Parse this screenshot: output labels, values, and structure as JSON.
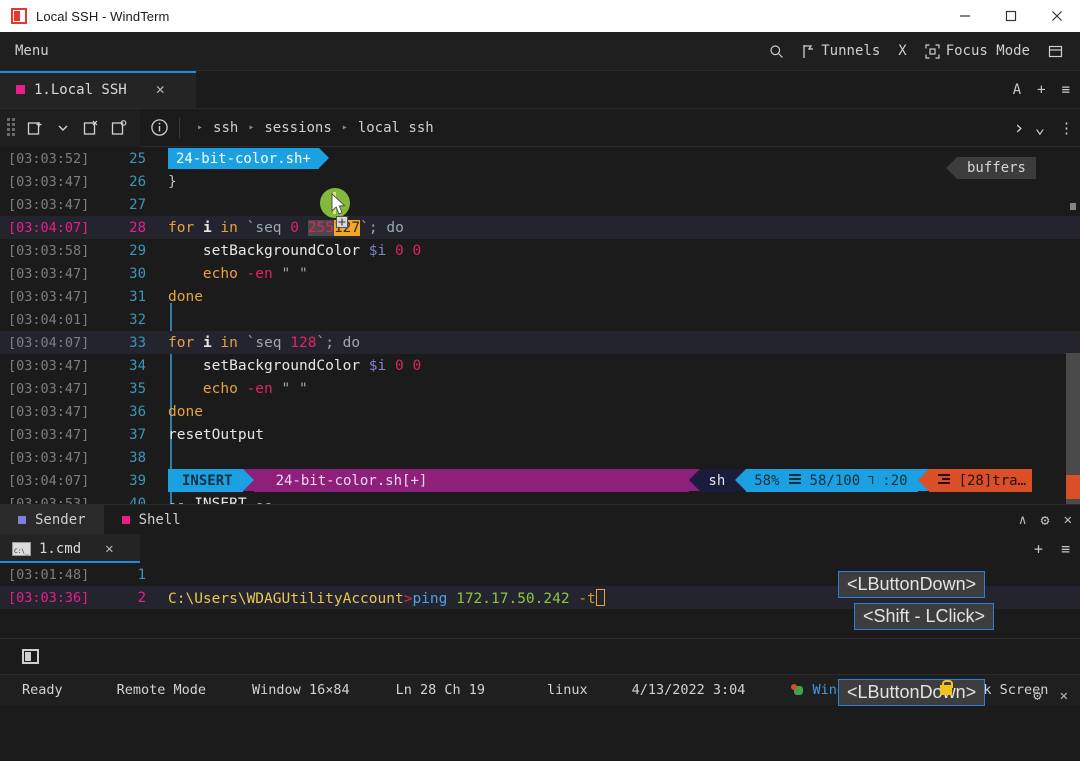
{
  "window": {
    "title": "Local SSH - WindTerm",
    "logo_icon": "windterm-logo-icon",
    "minimize_label": "─",
    "maximize_label": "□",
    "close_label": "✕"
  },
  "menubar": {
    "menu_label": "Menu",
    "search_icon": "search-icon",
    "tunnels_icon": "tunnel-flag-icon",
    "tunnels_label": "Tunnels",
    "x_label": "X",
    "focus_icon": "focus-frame-icon",
    "focus_label": "Focus Mode",
    "layout_icon": "layout-panel-icon"
  },
  "session_tabs": {
    "items": [
      {
        "label": "1.Local SSH",
        "dot_color": "#e91e8c",
        "close_label": "✕",
        "active": true
      }
    ],
    "right_controls": [
      {
        "name": "font-size-button",
        "label": "A"
      },
      {
        "name": "new-tab-button",
        "label": "+"
      },
      {
        "name": "tab-menu-button",
        "label": "≡"
      }
    ]
  },
  "pathbar": {
    "grip_icon": "drag-grip-icon",
    "icons": [
      {
        "name": "new-session-icon",
        "label": "new-session"
      },
      {
        "name": "dropdown-caret-icon",
        "label": "▾"
      },
      {
        "name": "close-session-icon",
        "label": "close-session"
      },
      {
        "name": "clone-session-icon",
        "label": "clone-session"
      },
      {
        "name": "info-icon",
        "label": "i"
      }
    ],
    "crumbs": [
      "ssh",
      "sessions",
      "local ssh"
    ],
    "crumb_arrow": "▸",
    "right_controls": [
      {
        "name": "path-forward-icon",
        "label": "›"
      },
      {
        "name": "path-dropdown-icon",
        "label": "⌄"
      },
      {
        "name": "path-more-icon",
        "label": "⋮"
      }
    ]
  },
  "terminal_upper": {
    "buffers_tag": "buffers",
    "file_tag": "24-bit-color.sh+",
    "rows": [
      {
        "time": "[03:03:52]",
        "line": "25",
        "active": false,
        "highlight": false,
        "kind": "tag"
      },
      {
        "time": "[03:03:47]",
        "line": "26",
        "active": false,
        "highlight": false,
        "kind": "brace",
        "text": "}"
      },
      {
        "time": "[03:03:47]",
        "line": "27",
        "active": false,
        "highlight": false,
        "kind": "blank",
        "text": ""
      },
      {
        "time": "[03:04:07]",
        "line": "28",
        "active": true,
        "highlight": true,
        "kind": "for255"
      },
      {
        "time": "[03:03:58]",
        "line": "29",
        "active": false,
        "highlight": false,
        "kind": "setbg"
      },
      {
        "time": "[03:03:47]",
        "line": "30",
        "active": false,
        "highlight": false,
        "kind": "echo"
      },
      {
        "time": "[03:03:47]",
        "line": "31",
        "active": false,
        "highlight": false,
        "kind": "done"
      },
      {
        "time": "[03:04:01]",
        "line": "32",
        "active": false,
        "highlight": false,
        "kind": "blank",
        "text": ""
      },
      {
        "time": "[03:04:07]",
        "line": "33",
        "active": false,
        "highlight": true,
        "kind": "for128"
      },
      {
        "time": "[03:03:47]",
        "line": "34",
        "active": false,
        "highlight": false,
        "kind": "setbg"
      },
      {
        "time": "[03:03:47]",
        "line": "35",
        "active": false,
        "highlight": false,
        "kind": "echo"
      },
      {
        "time": "[03:03:47]",
        "line": "36",
        "active": false,
        "highlight": false,
        "kind": "done"
      },
      {
        "time": "[03:03:47]",
        "line": "37",
        "active": false,
        "highlight": false,
        "kind": "reset"
      },
      {
        "time": "[03:03:47]",
        "line": "38",
        "active": false,
        "highlight": false,
        "kind": "blank",
        "text": ""
      },
      {
        "time": "[03:04:07]",
        "line": "39",
        "active": false,
        "highlight": false,
        "kind": "statusline"
      },
      {
        "time": "[03:03:53]",
        "line": "40",
        "active": false,
        "highlight": false,
        "kind": "insert",
        "text": "-- INSERT --"
      }
    ],
    "code": {
      "for_kw": "for",
      "i_var": "i",
      "in_kw": "in",
      "backtick": "`",
      "seq_kw": "seq",
      "zero": "0",
      "seg255": "255",
      "seg127": "127",
      "tail_do": "`; do",
      "seq128_text": "128",
      "setbg_fn": "setBackgroundColor",
      "setbg_var": "$i",
      "setbg_args": "0 0",
      "echo_kw": "echo",
      "echo_flag": "-en",
      "echo_str": "\" \"",
      "done_kw": "done",
      "reset_fn": "resetOutput",
      "brace": "}",
      "insert_text": "-- INSERT --"
    },
    "statusline": {
      "mode": "INSERT",
      "file": "24-bit-color.sh[+]",
      "filetype": "sh",
      "percent": "58%",
      "lines_icon": "lines-icon",
      "position": "58/100",
      "col_icon": "⅂",
      "column": ":20",
      "tra_icon": "buffer-list-icon",
      "tra": "[28]tra…"
    }
  },
  "panel": {
    "tabs": [
      {
        "label": "Sender",
        "dot_color": "#7f7fd5",
        "active": true
      },
      {
        "label": "Shell",
        "dot_color": "#e91e8c",
        "active": false
      }
    ],
    "controls": [
      {
        "name": "collapse-panel-button",
        "label": "∧"
      },
      {
        "name": "panel-settings-button",
        "label": "⚙"
      },
      {
        "name": "close-panel-button",
        "label": "✕"
      }
    ],
    "sub_tabs": [
      {
        "label": "1.cmd",
        "icon": "cmd-console-icon",
        "close_label": "✕",
        "active": true
      }
    ],
    "sub_controls": [
      {
        "name": "new-shell-button",
        "label": "+"
      },
      {
        "name": "shell-menu-button",
        "label": "≡"
      }
    ]
  },
  "terminal_lower": {
    "rows": [
      {
        "time": "[03:01:48]",
        "line": "1",
        "active": false,
        "highlight": false,
        "text": ""
      },
      {
        "time": "[03:03:36]",
        "line": "2",
        "active": true,
        "highlight": true,
        "path": "C:\\Users\\WDAGUtilityAccount",
        "gt": ">",
        "cmd": "ping",
        "ip": "172.17.50.242",
        "flag": "-t"
      }
    ]
  },
  "key_overlays": [
    {
      "label": "<LButtonDown>"
    },
    {
      "label": "<Shift - LClick>"
    },
    {
      "label": "<LButtonDown>"
    }
  ],
  "bottom_strip": {
    "restore_icon": "restore-window-icon"
  },
  "statusbar": {
    "ready": "Ready",
    "mode": "Remote Mode",
    "window_size": "Window 16×84",
    "cursor": "Ln 28 Ch 19",
    "os": "linux",
    "datetime": "4/13/2022 3:04",
    "issues_icon": "bug-icon",
    "issues": "WindTerm Iss",
    "lock_icon": "lock-icon",
    "lock": "Lock Screen"
  },
  "colors": {
    "accent_blue": "#1b8ce3",
    "tab_pink": "#e91e8c",
    "statusline_blue": "#1ba1e2",
    "statusline_purple": "#8e1f7a",
    "statusline_orange": "#da4e28",
    "highlight_amber": "#f5a623"
  }
}
